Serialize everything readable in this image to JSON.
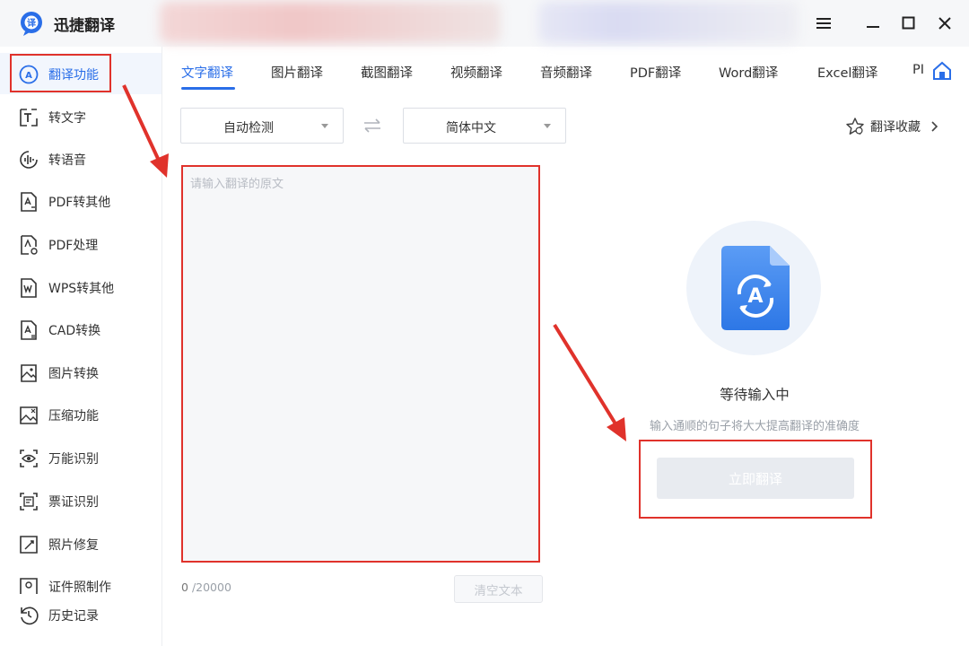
{
  "app": {
    "title": "迅捷翻译",
    "logo_icon": "translate-bubble-icon",
    "window_controls": [
      "menu-icon",
      "minimize-icon",
      "maximize-icon",
      "close-icon"
    ]
  },
  "sidebar": {
    "items": [
      {
        "label": "翻译功能",
        "icon": "translate-circle-icon",
        "active": true
      },
      {
        "label": "转文字",
        "icon": "text-convert-icon"
      },
      {
        "label": "转语音",
        "icon": "voice-wave-icon"
      },
      {
        "label": "PDF转其他",
        "icon": "pdf-convert-icon"
      },
      {
        "label": "PDF处理",
        "icon": "pdf-settings-icon"
      },
      {
        "label": "WPS转其他",
        "icon": "wps-convert-icon"
      },
      {
        "label": "CAD转换",
        "icon": "cad-convert-icon"
      },
      {
        "label": "图片转换",
        "icon": "image-convert-icon"
      },
      {
        "label": "压缩功能",
        "icon": "compress-image-icon"
      },
      {
        "label": "万能识别",
        "icon": "eye-scan-icon"
      },
      {
        "label": "票证识别",
        "icon": "ticket-scan-icon"
      },
      {
        "label": "照片修复",
        "icon": "photo-repair-icon"
      },
      {
        "label": "证件照制作",
        "icon": "id-photo-icon"
      }
    ],
    "history": {
      "label": "历史记录",
      "icon": "history-icon"
    }
  },
  "tabs": [
    {
      "label": "文字翻译",
      "active": true
    },
    {
      "label": "图片翻译"
    },
    {
      "label": "截图翻译"
    },
    {
      "label": "视频翻译"
    },
    {
      "label": "音频翻译"
    },
    {
      "label": "PDF翻译"
    },
    {
      "label": "Word翻译"
    },
    {
      "label": "Excel翻译"
    },
    {
      "label": "PI"
    }
  ],
  "language": {
    "source": "自动检测",
    "target": "简体中文"
  },
  "favorites_label": "翻译收藏",
  "editor": {
    "placeholder": "请输入翻译的原文",
    "count_current": "0",
    "count_max": "/20000",
    "clear_label": "清空文本"
  },
  "result": {
    "title": "等待输入中",
    "subtitle": "输入通顺的句子将大大提高翻译的准确度",
    "button_label": "立即翻译"
  },
  "colors": {
    "accent": "#2a6ee8",
    "annotation": "#e0322b"
  }
}
